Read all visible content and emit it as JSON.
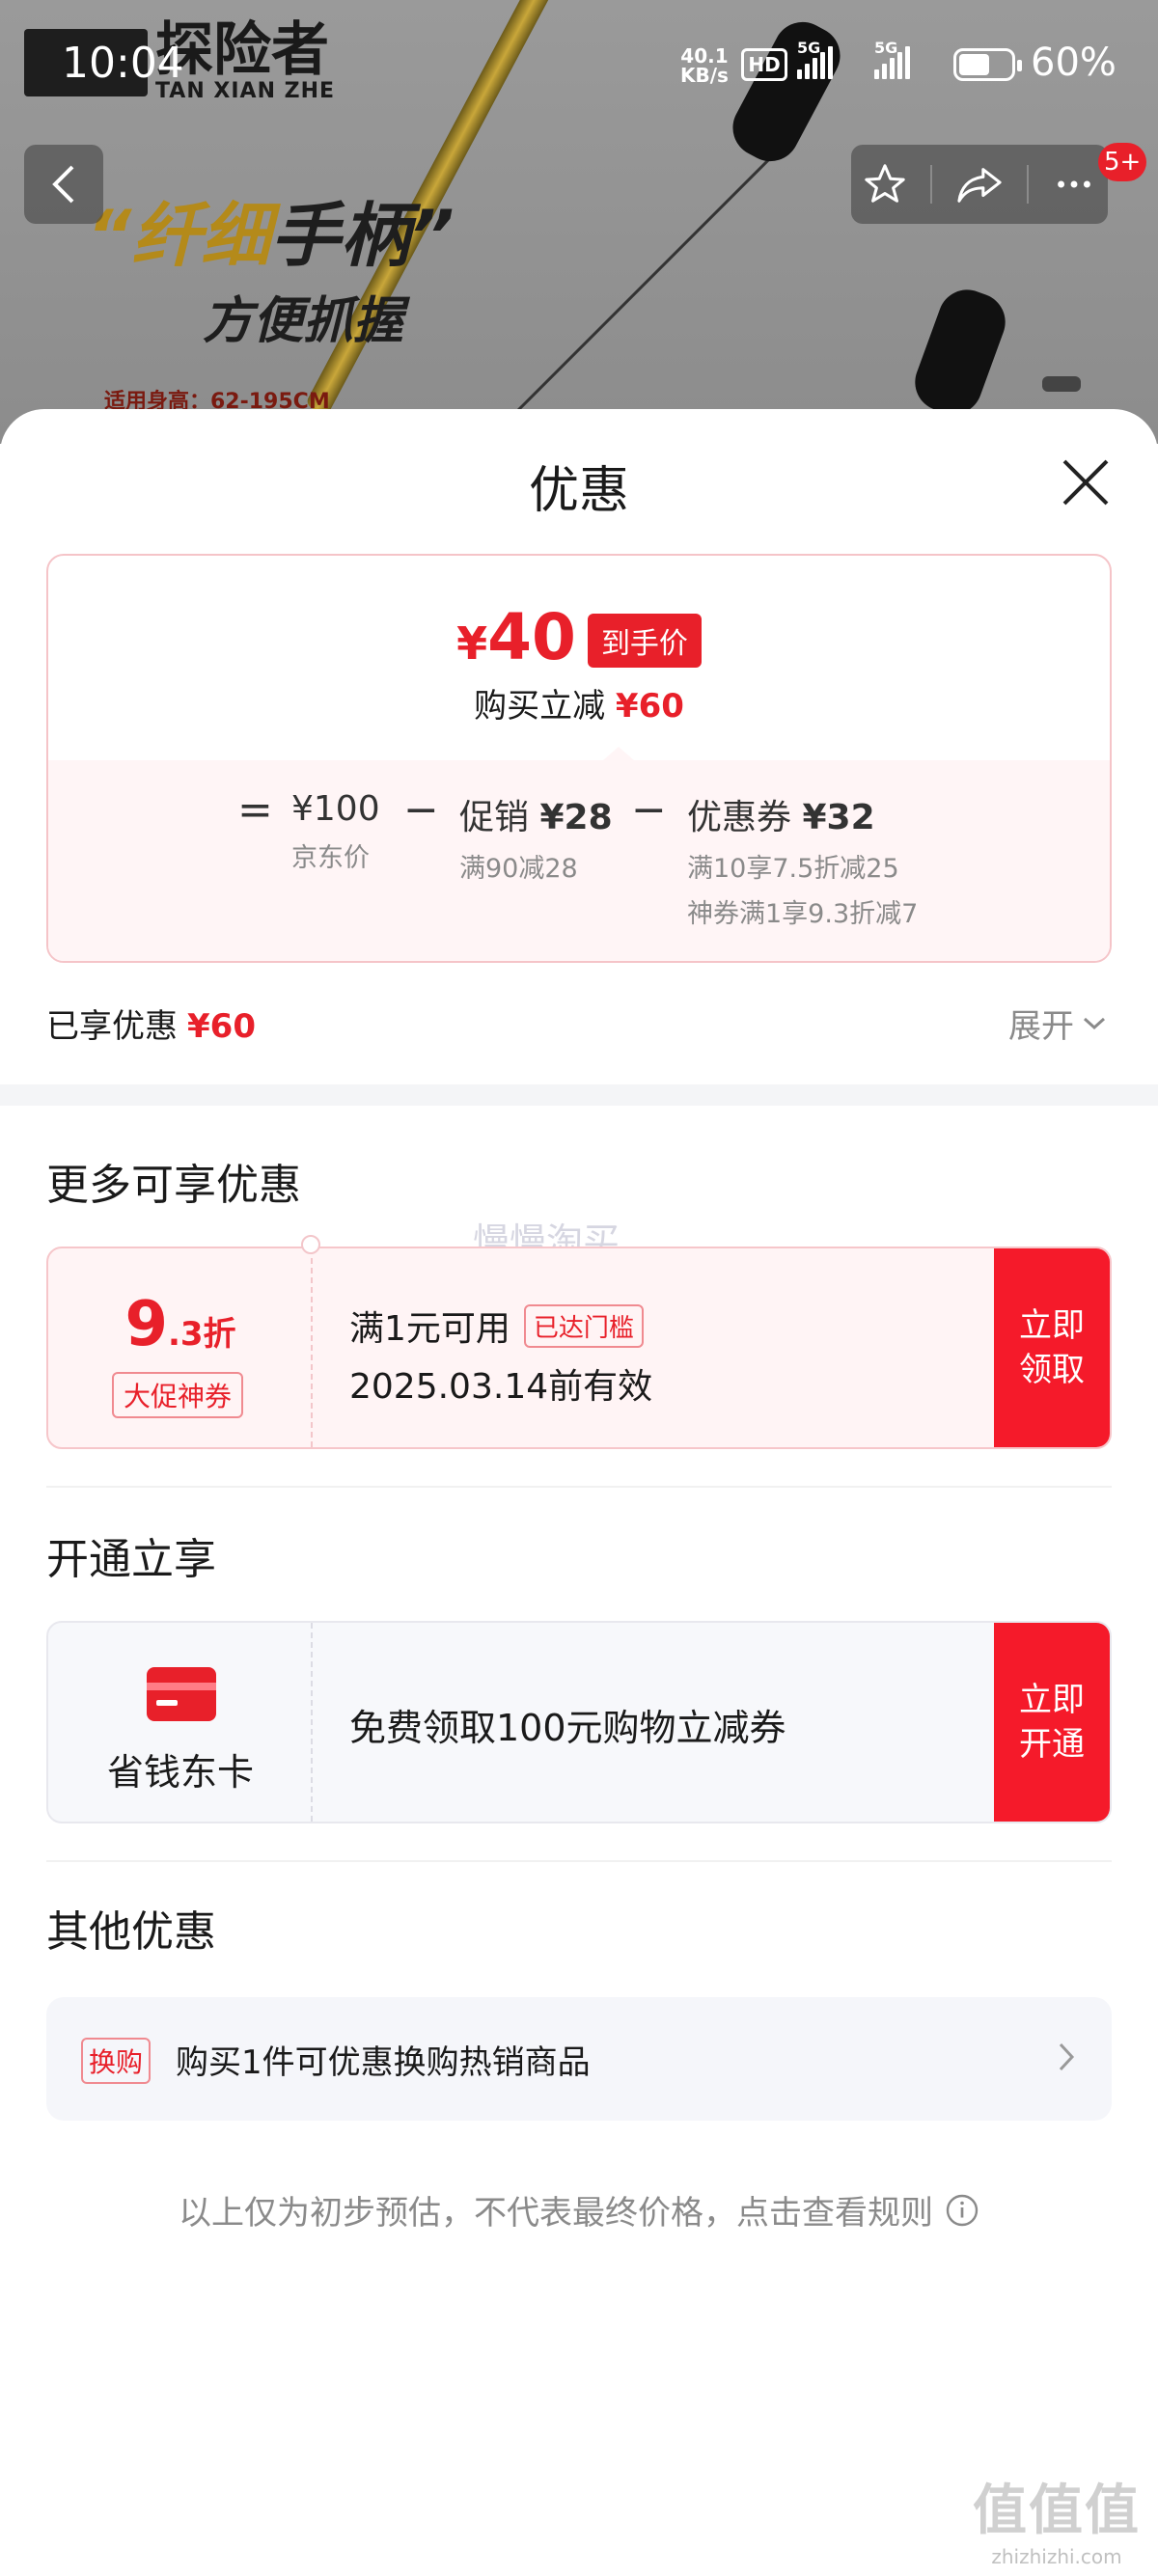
{
  "status_bar": {
    "time": "10:04",
    "network_speed": "40.1",
    "network_unit": "KB/s",
    "hd_label": "HD",
    "signal1_label": "5G",
    "signal2_label": "5G",
    "battery_percent": "60%",
    "battery_level": 0.6
  },
  "background": {
    "brand_cn": "探险者",
    "brand_en": "TAN XIAN ZHE",
    "slogan_part1": "“纤细",
    "slogan_part2": "手柄”",
    "slogan_line2": "方便抓握",
    "height_note": "适用身高：62-195CM",
    "badge_count": "5+"
  },
  "sheet": {
    "title": "优惠"
  },
  "price_card": {
    "currency": "¥",
    "final_price": "40",
    "final_tag": "到手价",
    "reduce_label": "购买立减",
    "reduce_amount": "¥60",
    "breakdown": {
      "equals": "=",
      "minus": "−",
      "jd_price_main": "¥100",
      "jd_price_sub": "京东价",
      "promo_label": "促销",
      "promo_amount": "¥28",
      "promo_sub": "满90减28",
      "coupon_label": "优惠券",
      "coupon_amount": "¥32",
      "coupon_sub1": "满10享7.5折减25",
      "coupon_sub2": "神券满1享9.3折减7"
    }
  },
  "enjoyed": {
    "label": "已享优惠",
    "amount": "¥60",
    "expand_label": "展开"
  },
  "more_offers": {
    "title": "更多可享优惠",
    "watermark": "慢慢淘买",
    "coupon": {
      "discount_big": "9",
      "discount_small": ".3折",
      "tag": "大促神券",
      "condition": "满1元可用",
      "reached": "已达门槛",
      "valid": "2025.03.14前有效",
      "cta": "立即领取"
    }
  },
  "open_enjoy": {
    "title": "开通立享",
    "card_label": "省钱东卡",
    "description": "免费领取100元购物立减券",
    "cta": "立即开通"
  },
  "other_offers": {
    "title": "其他优惠",
    "tag": "换购",
    "text": "购买1件可优惠换购热销商品"
  },
  "footer": {
    "text": "以上仅为初步预估，不代表最终价格，点击查看规则"
  },
  "corner_watermark": {
    "logo": "值值值",
    "url": "zhizhizhi.com"
  },
  "colors": {
    "accent_red": "#e8202a",
    "cta_red": "#f51a2a",
    "muted": "#8a8a8a"
  }
}
